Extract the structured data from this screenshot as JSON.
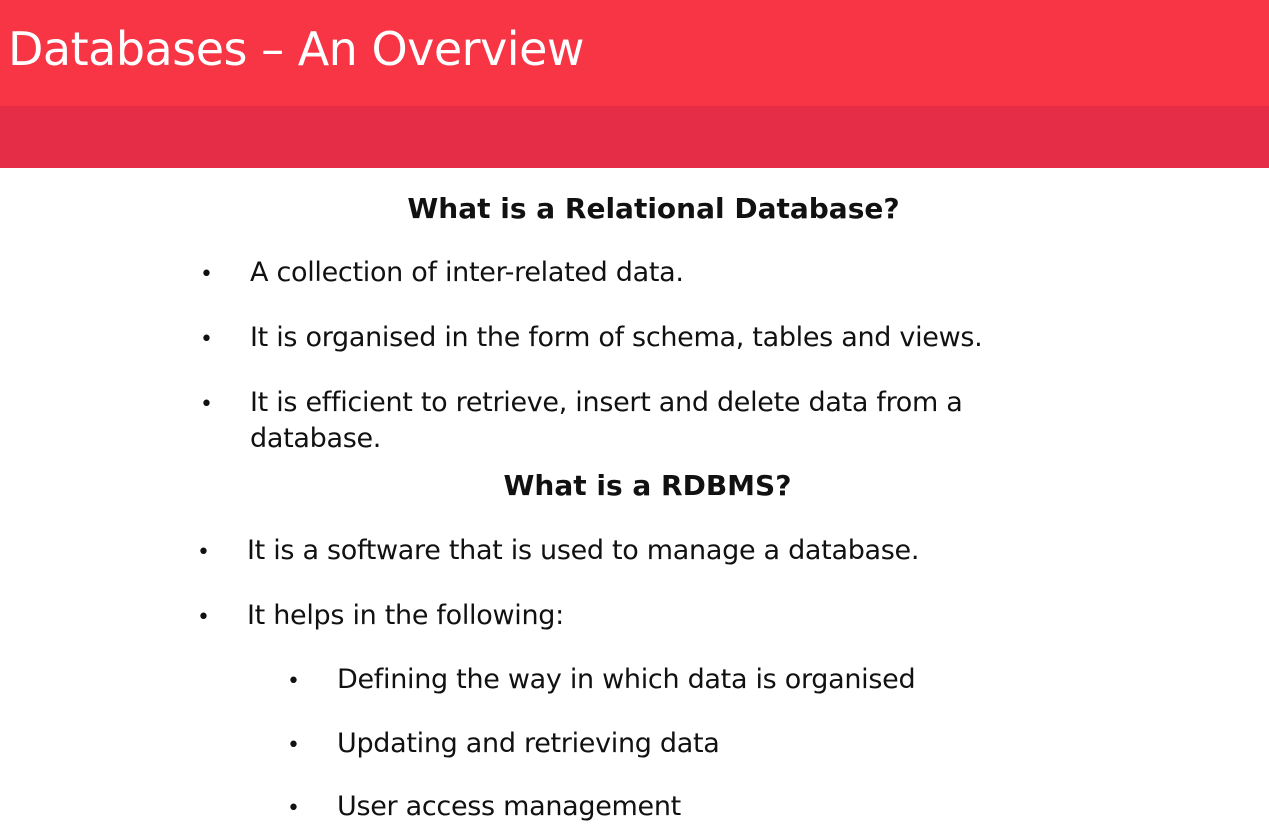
{
  "slide": {
    "title": "Databases – An Overview"
  },
  "section1": {
    "heading": "What is a Relational Database?",
    "bullets": [
      "A collection of inter-related data.",
      "It is organised in the form of schema, tables and views.",
      "It is efficient to retrieve, insert and delete data from a",
      "database."
    ]
  },
  "section2": {
    "heading": "What is a RDBMS?",
    "bullets": [
      "It is a software that is used to manage a database.",
      "It helps in the following:"
    ],
    "subbullets": [
      "Defining the way in which data is organised",
      "Updating and retrieving data",
      "User access management"
    ]
  },
  "bullet_glyph": "•",
  "colors": {
    "header": "#f73544",
    "header_band": "#e52d47",
    "text": "#111111"
  }
}
